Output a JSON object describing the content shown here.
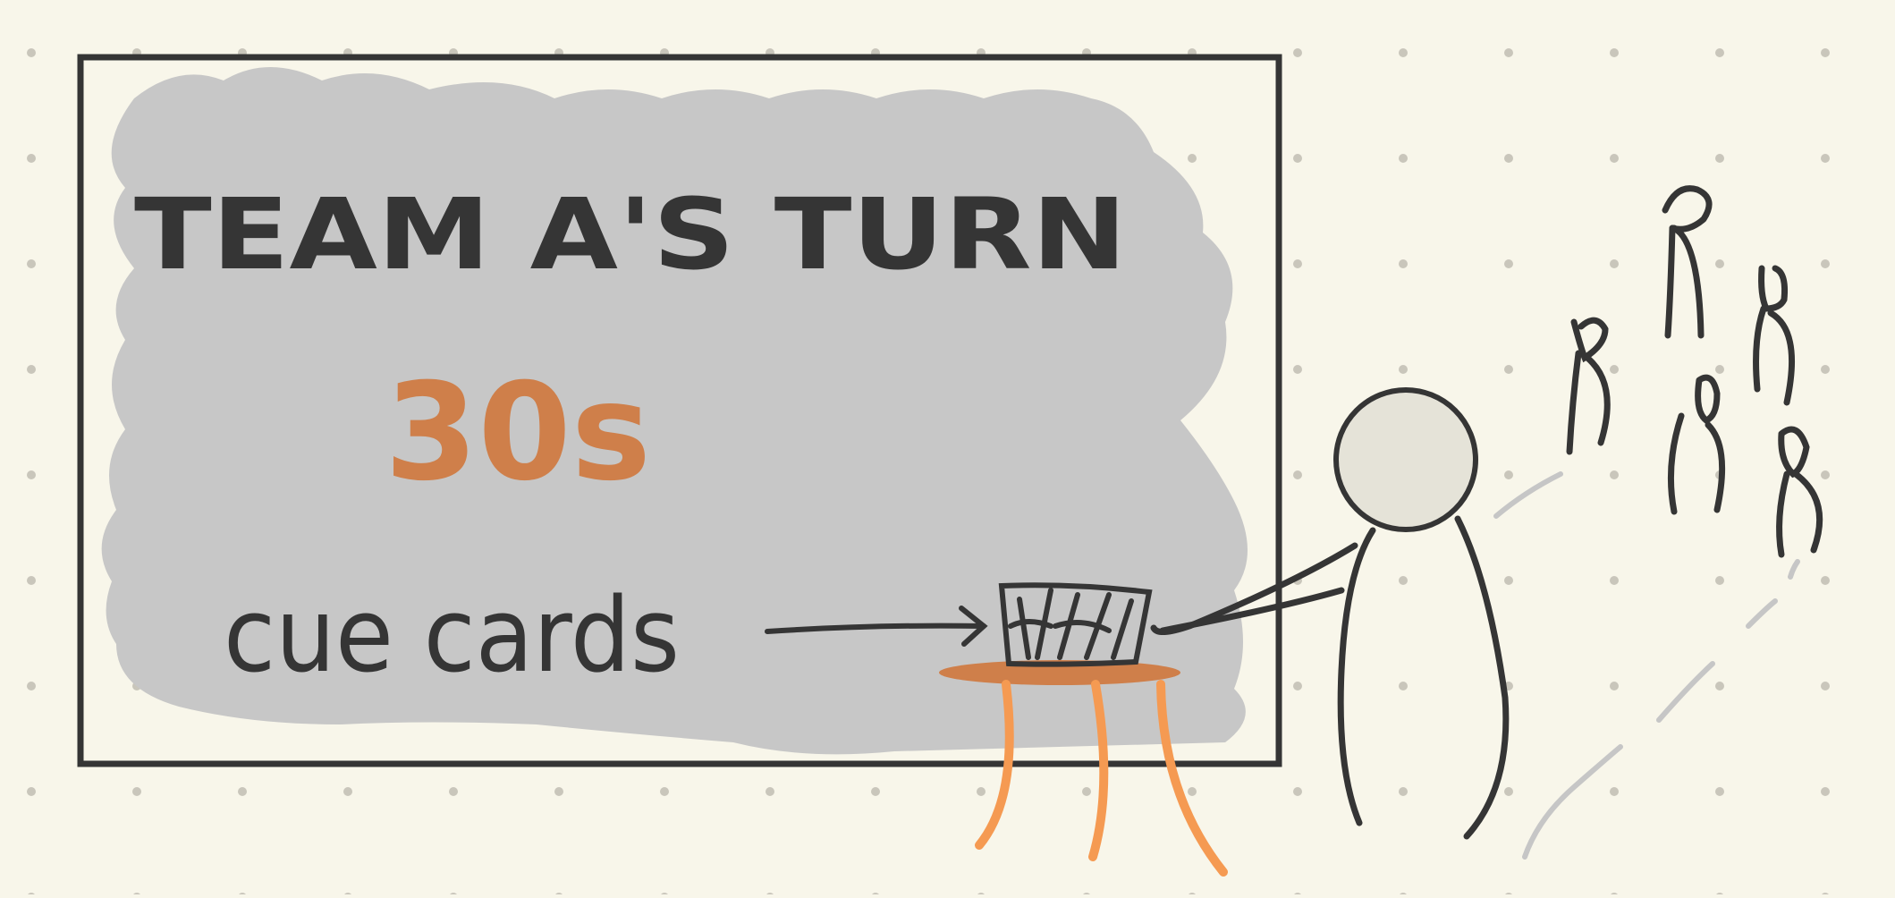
{
  "canvas": {
    "background": "#f8f6ea",
    "dot_color": "#c9c6bb",
    "ink_color": "#353535",
    "accent_color": "#cf7f4a",
    "table_leg_color": "#f59a52",
    "cloud_fill": "#c7c7c7",
    "head_fill": "#e5e3d8",
    "motion_line_color": "#c6c6c6"
  },
  "board": {
    "title": "TEAM A'S TURN",
    "timer": "30s",
    "cue_label": "cue cards"
  },
  "icons": {
    "presenter": "stick-figure-presenter-icon",
    "cards": "cue-card-stack-icon",
    "table": "table-icon",
    "audience": "audience-figures-icon"
  }
}
